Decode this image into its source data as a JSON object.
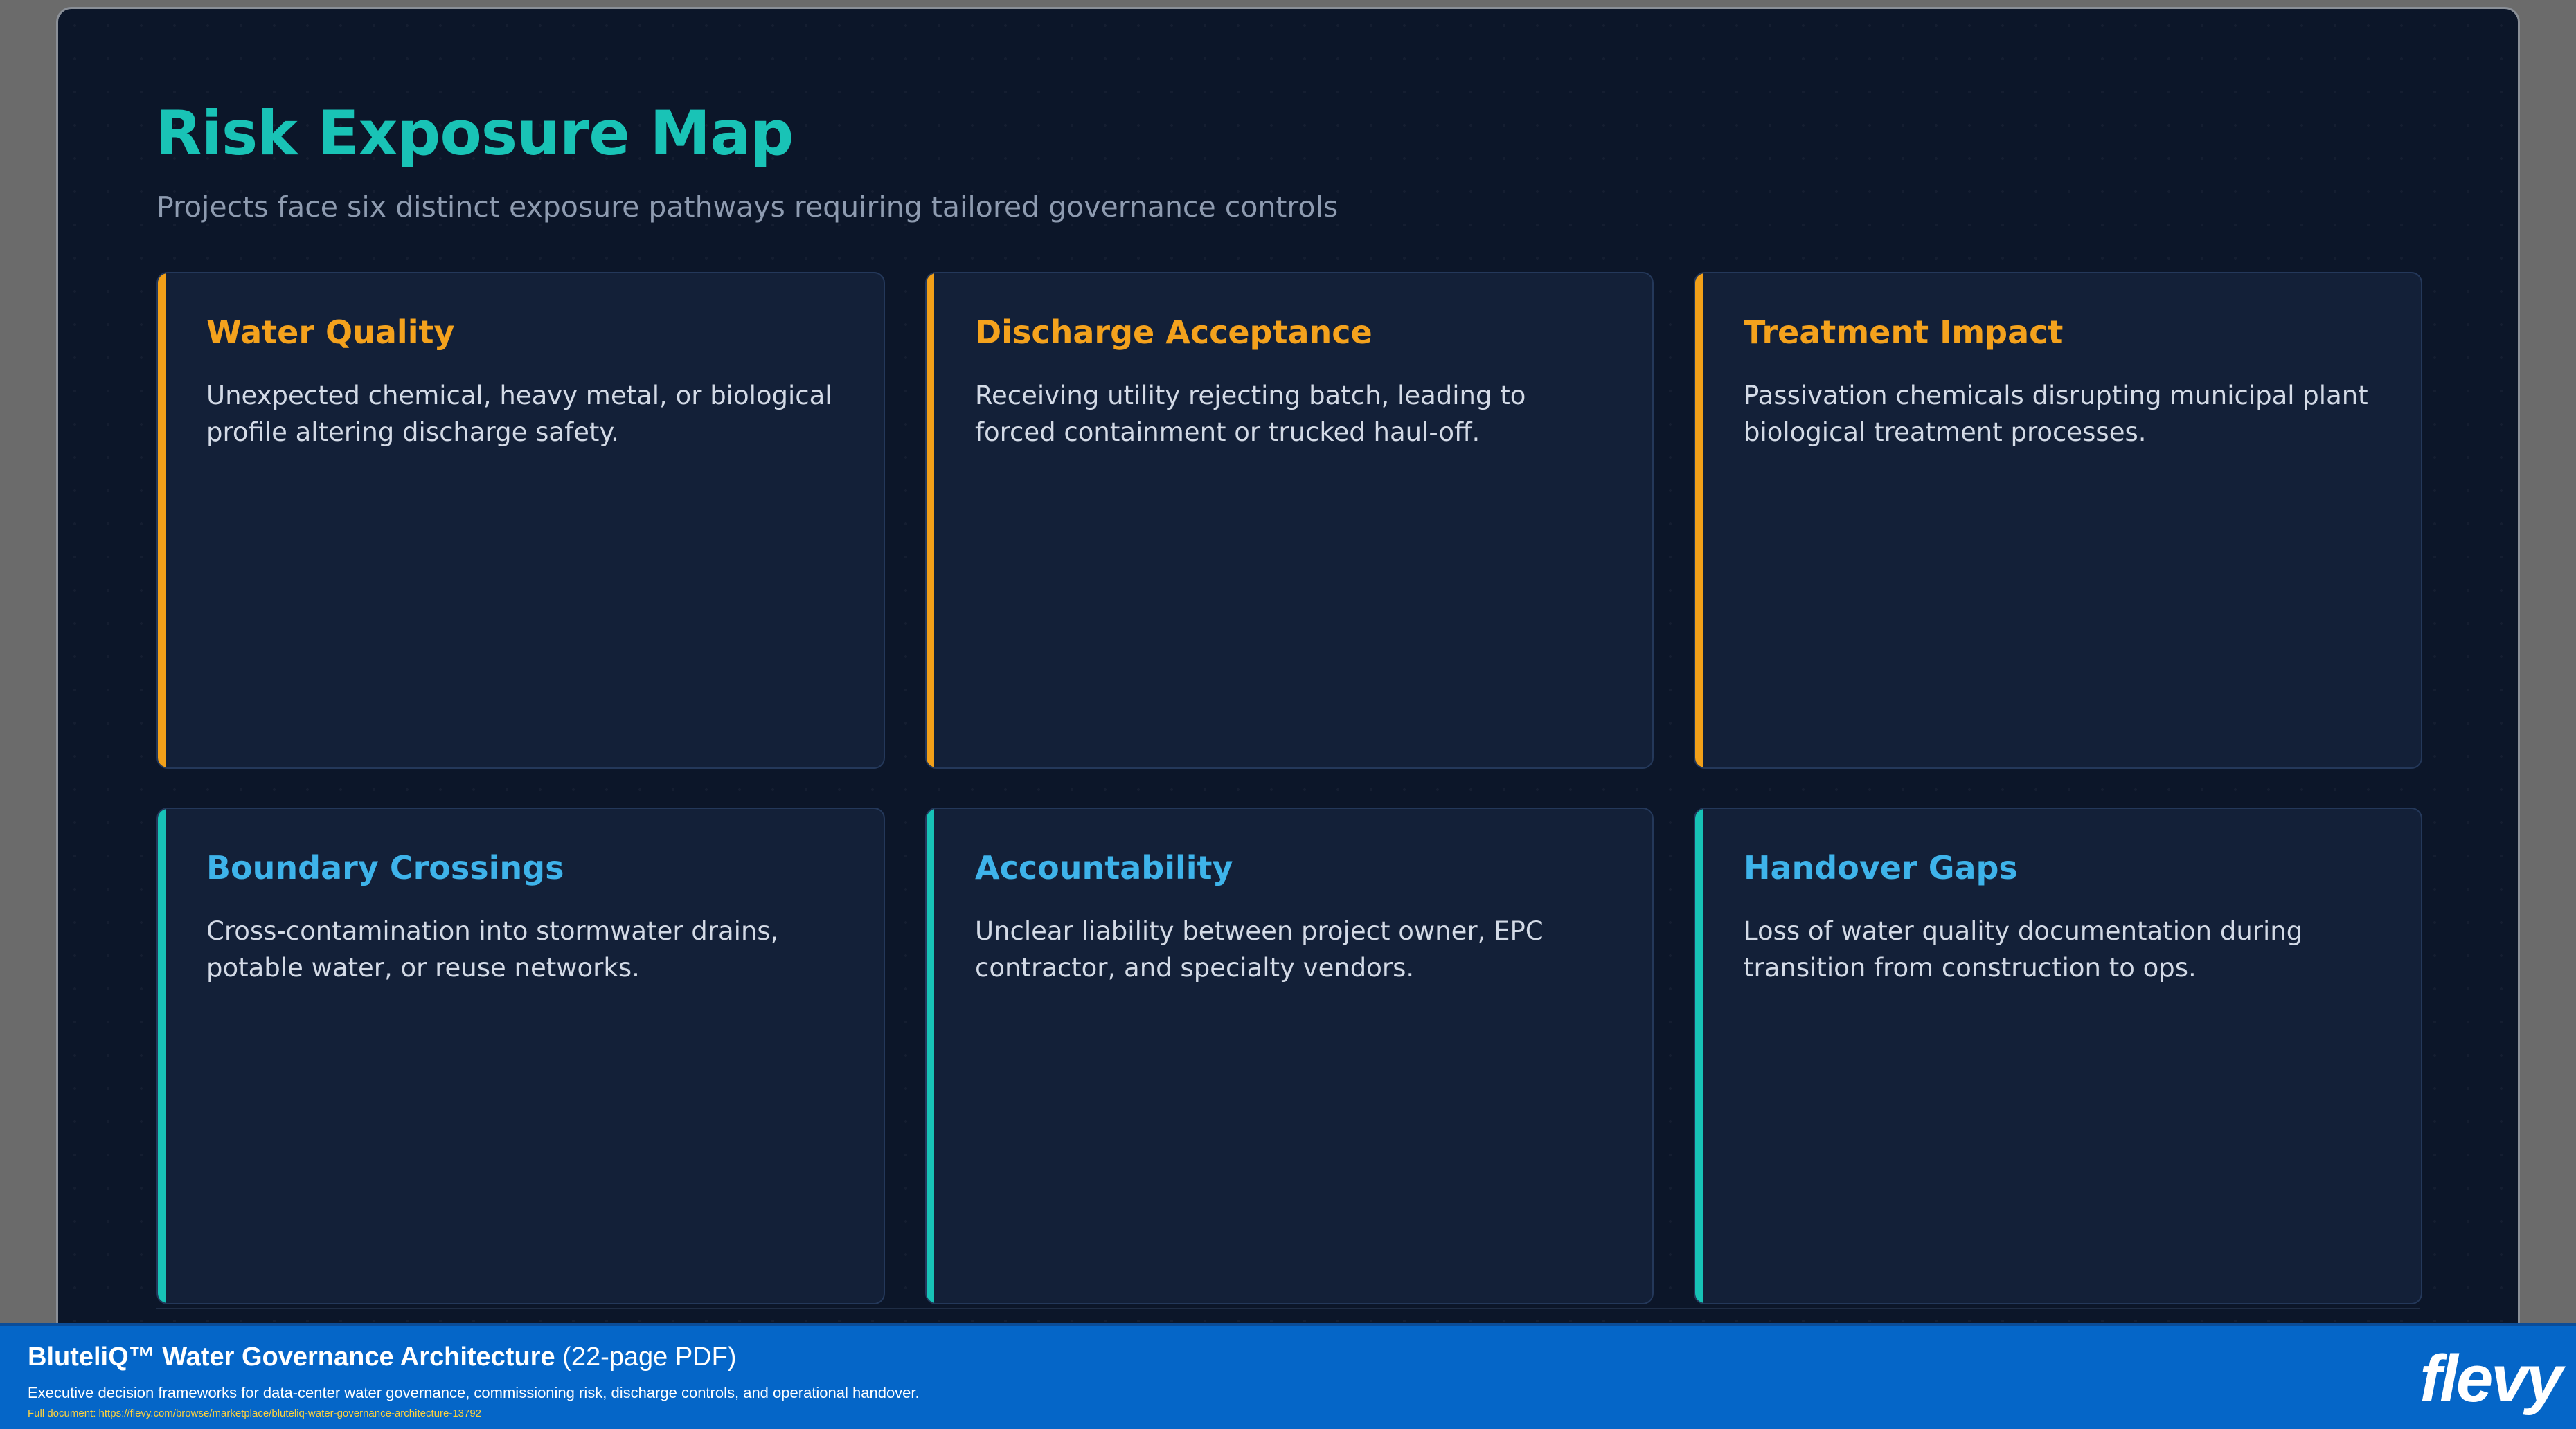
{
  "page": {
    "title": "Risk Exposure Map",
    "subtitle": "Projects face six distinct exposure pathways requiring tailored governance controls"
  },
  "cards": [
    {
      "title": "Water Quality",
      "body": "Unexpected chemical, heavy metal, or biological profile altering discharge safety.",
      "accent": "#f2a019"
    },
    {
      "title": "Discharge Acceptance",
      "body": "Receiving utility rejecting batch, leading to forced containment or trucked haul-off.",
      "accent": "#f2a019"
    },
    {
      "title": "Treatment Impact",
      "body": "Passivation chemicals disrupting municipal plant biological treatment processes.",
      "accent": "#f2a019"
    },
    {
      "title": "Boundary Crossings",
      "body": "Cross-contamination into stormwater drains, potable water, or reuse networks.",
      "accent": "#17c2b6"
    },
    {
      "title": "Accountability",
      "body": "Unclear liability between project owner, EPC contractor, and specialty vendors.",
      "accent": "#17c2b6"
    },
    {
      "title": "Handover Gaps",
      "body": "Loss of water quality documentation during transition from construction to ops.",
      "accent": "#17c2b6"
    }
  ],
  "banner": {
    "product_name": "BluteliQ™ Water Governance Architecture",
    "product_meta": "(22-page PDF)",
    "description": "Executive decision frameworks for data-center water governance, commissioning risk, discharge controls, and operational handover.",
    "link_text": "Full document: https://flevy.com/browse/marketplace/bluteliq-water-governance-architecture-13792",
    "logo": "flevy",
    "color": "#0566c8"
  }
}
